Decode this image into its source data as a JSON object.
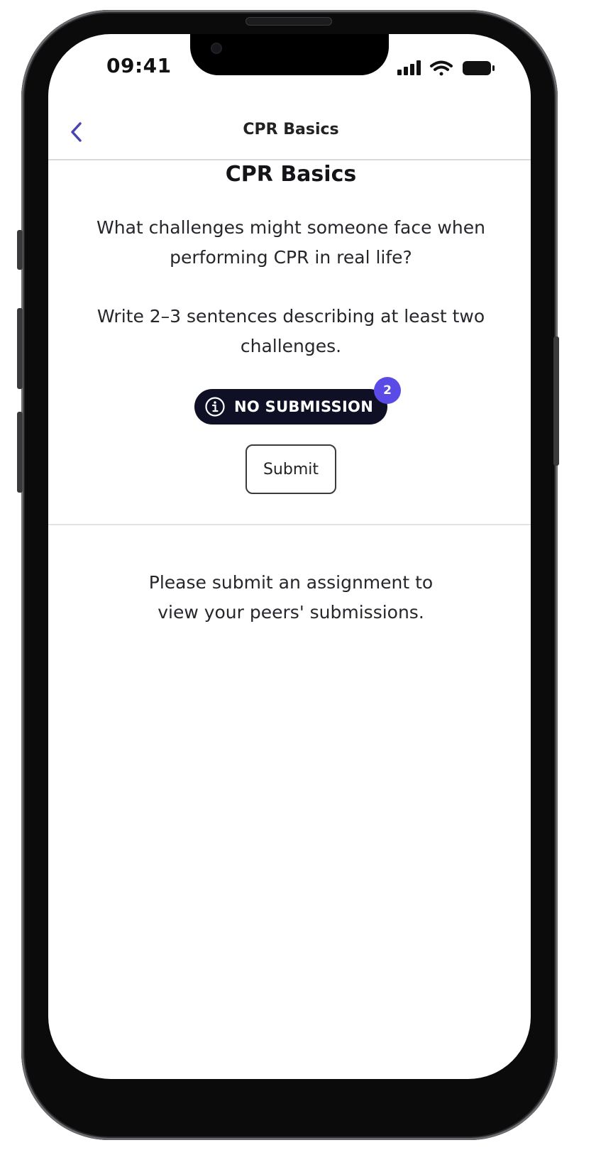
{
  "status_bar": {
    "time": "09:41",
    "icons": [
      "cellular-signal-icon",
      "wifi-icon",
      "battery-icon"
    ]
  },
  "nav": {
    "back_icon": "chevron-left-icon",
    "title": "CPR Basics"
  },
  "content": {
    "title": "CPR Basics",
    "question": "What challenges might someone face when performing CPR in real life?",
    "instruction": "Write 2–3 sentences describing at least two challenges."
  },
  "submission_status": {
    "icon": "info-icon",
    "label": "NO SUBMISSION",
    "badge_count": "2"
  },
  "submit_button": {
    "label": "Submit"
  },
  "peers": {
    "message_line1": "Please submit an assignment to",
    "message_line2": "view your peers' submissions."
  },
  "colors": {
    "accent": "#5b4be6",
    "pill_background": "#0f0f25",
    "back_chevron": "#4a44b0",
    "text": "#26262c"
  }
}
